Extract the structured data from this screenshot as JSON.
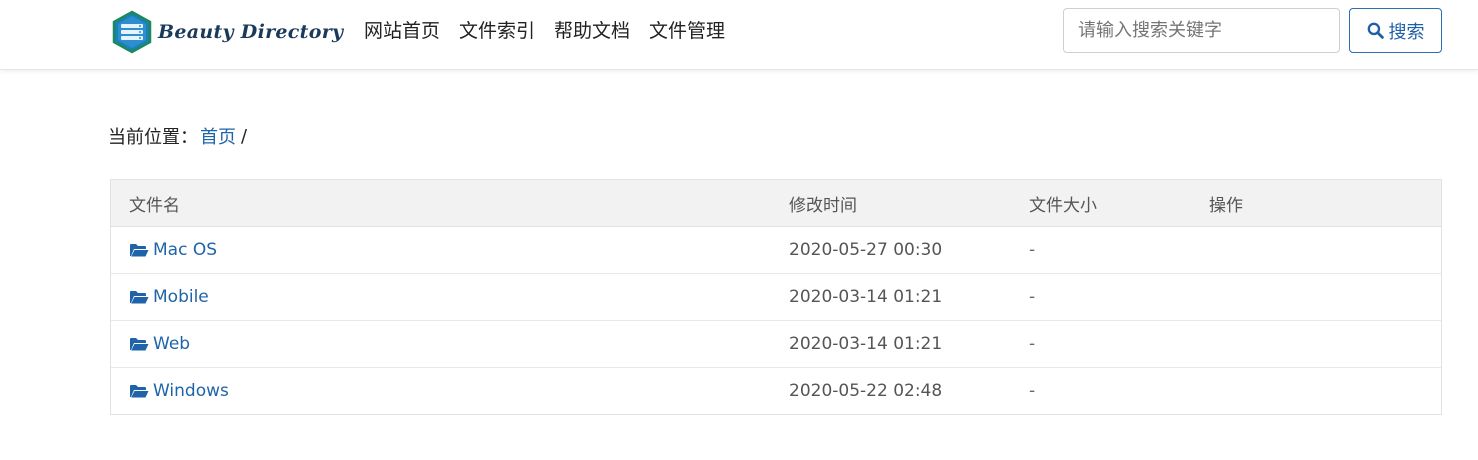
{
  "brand": {
    "name": "Beauty Directory",
    "logo_icon": "database-hexagon-icon"
  },
  "nav": {
    "items": [
      {
        "label": "网站首页"
      },
      {
        "label": "文件索引"
      },
      {
        "label": "帮助文档"
      },
      {
        "label": "文件管理"
      }
    ]
  },
  "search": {
    "placeholder": "请输入搜索关键字",
    "value": "",
    "button_label": "搜索",
    "icon": "search-icon"
  },
  "breadcrumb": {
    "prefix": "当前位置：",
    "home": "首页",
    "separator": "/"
  },
  "table": {
    "headers": {
      "name": "文件名",
      "modified": "修改时间",
      "size": "文件大小",
      "actions": "操作"
    },
    "rows": [
      {
        "name": "Mac OS",
        "modified": "2020-05-27 00:30",
        "size": "-",
        "icon": "folder-open-icon"
      },
      {
        "name": "Mobile",
        "modified": "2020-03-14 01:21",
        "size": "-",
        "icon": "folder-open-icon"
      },
      {
        "name": "Web",
        "modified": "2020-03-14 01:21",
        "size": "-",
        "icon": "folder-open-icon"
      },
      {
        "name": "Windows",
        "modified": "2020-05-22 02:48",
        "size": "-",
        "icon": "folder-open-icon"
      }
    ]
  },
  "colors": {
    "link": "#1f64a8",
    "brand": "#1b3a5b",
    "header_bg": "#f2f2f2",
    "button_border": "#2a6eb5"
  }
}
